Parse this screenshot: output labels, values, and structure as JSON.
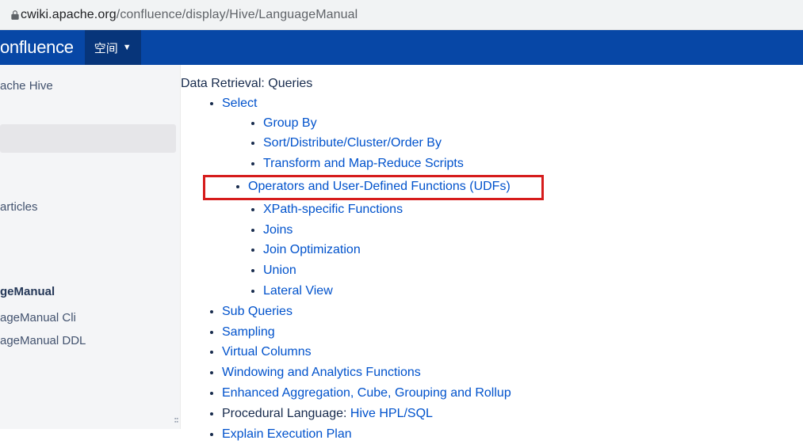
{
  "url": {
    "domain": "cwiki.apache.org",
    "path": "/confluence/display/Hive/LanguageManual"
  },
  "header": {
    "logo": "onfluence",
    "space_menu": "空间"
  },
  "sidebar": {
    "title": "ache Hive",
    "articles_label": "articles",
    "current_page": "geManual",
    "sub1": "ageManual Cli",
    "sub2": "ageManual DDL"
  },
  "main": {
    "section_title": "Data Retrieval: Queries",
    "select_label": "Select",
    "level3_items": [
      "Group By",
      "Sort/Distribute/Cluster/Order By",
      "Transform and Map-Reduce Scripts",
      "Operators and User-Defined Functions (UDFs)",
      "XPath-specific Functions",
      "Joins",
      "Join Optimization",
      "Union",
      "Lateral View"
    ],
    "level2_items": [
      "Sub Queries",
      "Sampling",
      "Virtual Columns",
      "Windowing and Analytics Functions",
      "Enhanced Aggregation, Cube, Grouping and Rollup"
    ],
    "procedural_prefix": "Procedural Language:  ",
    "procedural_link": "Hive HPL/SQL",
    "explain_label": "Explain Execution Plan"
  },
  "highlighted_index": 3
}
